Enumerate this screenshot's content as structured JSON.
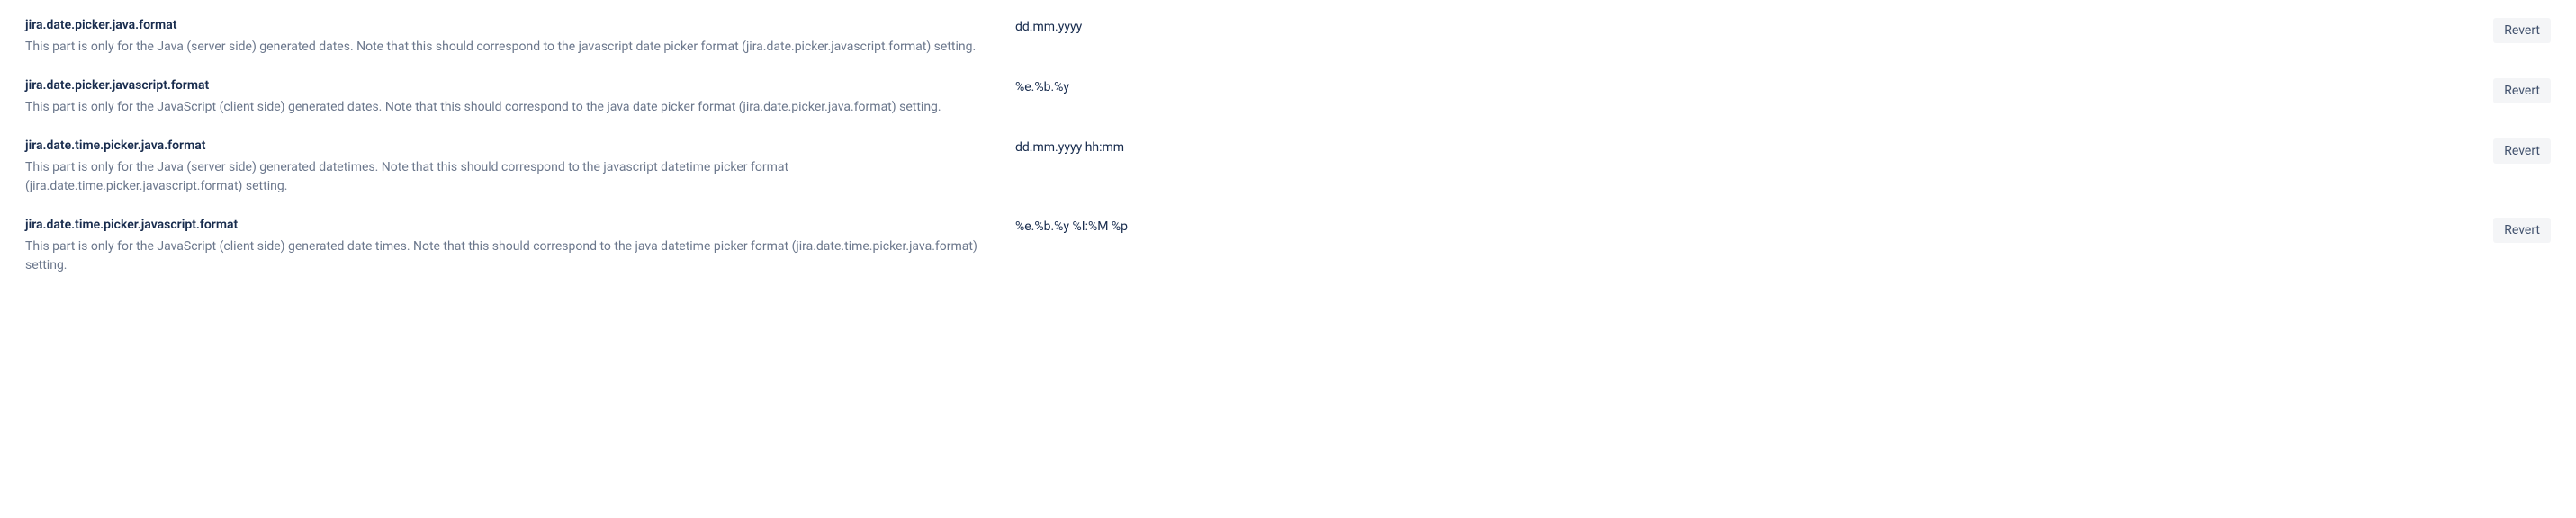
{
  "settings": [
    {
      "key": "jira.date.picker.java.format",
      "description": "This part is only for the Java (server side) generated dates. Note that this should correspond to the javascript date picker format (jira.date.picker.javascript.format) setting.",
      "value": "dd.mm.yyyy",
      "action_label": "Revert"
    },
    {
      "key": "jira.date.picker.javascript.format",
      "description": "This part is only for the JavaScript (client side) generated dates. Note that this should correspond to the java date picker format (jira.date.picker.java.format) setting.",
      "value": "%e.%b.%y",
      "action_label": "Revert"
    },
    {
      "key": "jira.date.time.picker.java.format",
      "description": "This part is only for the Java (server side) generated datetimes. Note that this should correspond to the javascript datetime picker format (jira.date.time.picker.javascript.format) setting.",
      "value": "dd.mm.yyyy hh:mm",
      "action_label": "Revert"
    },
    {
      "key": "jira.date.time.picker.javascript.format",
      "description": "This part is only for the JavaScript (client side) generated date times. Note that this should correspond to the java datetime picker format (jira.date.time.picker.java.format) setting.",
      "value": "%e.%b.%y %I:%M %p",
      "action_label": "Revert"
    }
  ]
}
